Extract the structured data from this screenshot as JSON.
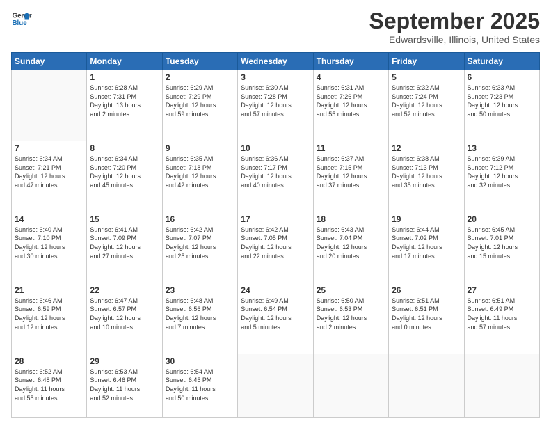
{
  "logo": {
    "line1": "General",
    "line2": "Blue"
  },
  "title": "September 2025",
  "location": "Edwardsville, Illinois, United States",
  "weekdays": [
    "Sunday",
    "Monday",
    "Tuesday",
    "Wednesday",
    "Thursday",
    "Friday",
    "Saturday"
  ],
  "weeks": [
    [
      {
        "day": "",
        "info": ""
      },
      {
        "day": "1",
        "info": "Sunrise: 6:28 AM\nSunset: 7:31 PM\nDaylight: 13 hours\nand 2 minutes."
      },
      {
        "day": "2",
        "info": "Sunrise: 6:29 AM\nSunset: 7:29 PM\nDaylight: 12 hours\nand 59 minutes."
      },
      {
        "day": "3",
        "info": "Sunrise: 6:30 AM\nSunset: 7:28 PM\nDaylight: 12 hours\nand 57 minutes."
      },
      {
        "day": "4",
        "info": "Sunrise: 6:31 AM\nSunset: 7:26 PM\nDaylight: 12 hours\nand 55 minutes."
      },
      {
        "day": "5",
        "info": "Sunrise: 6:32 AM\nSunset: 7:24 PM\nDaylight: 12 hours\nand 52 minutes."
      },
      {
        "day": "6",
        "info": "Sunrise: 6:33 AM\nSunset: 7:23 PM\nDaylight: 12 hours\nand 50 minutes."
      }
    ],
    [
      {
        "day": "7",
        "info": "Sunrise: 6:34 AM\nSunset: 7:21 PM\nDaylight: 12 hours\nand 47 minutes."
      },
      {
        "day": "8",
        "info": "Sunrise: 6:34 AM\nSunset: 7:20 PM\nDaylight: 12 hours\nand 45 minutes."
      },
      {
        "day": "9",
        "info": "Sunrise: 6:35 AM\nSunset: 7:18 PM\nDaylight: 12 hours\nand 42 minutes."
      },
      {
        "day": "10",
        "info": "Sunrise: 6:36 AM\nSunset: 7:17 PM\nDaylight: 12 hours\nand 40 minutes."
      },
      {
        "day": "11",
        "info": "Sunrise: 6:37 AM\nSunset: 7:15 PM\nDaylight: 12 hours\nand 37 minutes."
      },
      {
        "day": "12",
        "info": "Sunrise: 6:38 AM\nSunset: 7:13 PM\nDaylight: 12 hours\nand 35 minutes."
      },
      {
        "day": "13",
        "info": "Sunrise: 6:39 AM\nSunset: 7:12 PM\nDaylight: 12 hours\nand 32 minutes."
      }
    ],
    [
      {
        "day": "14",
        "info": "Sunrise: 6:40 AM\nSunset: 7:10 PM\nDaylight: 12 hours\nand 30 minutes."
      },
      {
        "day": "15",
        "info": "Sunrise: 6:41 AM\nSunset: 7:09 PM\nDaylight: 12 hours\nand 27 minutes."
      },
      {
        "day": "16",
        "info": "Sunrise: 6:42 AM\nSunset: 7:07 PM\nDaylight: 12 hours\nand 25 minutes."
      },
      {
        "day": "17",
        "info": "Sunrise: 6:42 AM\nSunset: 7:05 PM\nDaylight: 12 hours\nand 22 minutes."
      },
      {
        "day": "18",
        "info": "Sunrise: 6:43 AM\nSunset: 7:04 PM\nDaylight: 12 hours\nand 20 minutes."
      },
      {
        "day": "19",
        "info": "Sunrise: 6:44 AM\nSunset: 7:02 PM\nDaylight: 12 hours\nand 17 minutes."
      },
      {
        "day": "20",
        "info": "Sunrise: 6:45 AM\nSunset: 7:01 PM\nDaylight: 12 hours\nand 15 minutes."
      }
    ],
    [
      {
        "day": "21",
        "info": "Sunrise: 6:46 AM\nSunset: 6:59 PM\nDaylight: 12 hours\nand 12 minutes."
      },
      {
        "day": "22",
        "info": "Sunrise: 6:47 AM\nSunset: 6:57 PM\nDaylight: 12 hours\nand 10 minutes."
      },
      {
        "day": "23",
        "info": "Sunrise: 6:48 AM\nSunset: 6:56 PM\nDaylight: 12 hours\nand 7 minutes."
      },
      {
        "day": "24",
        "info": "Sunrise: 6:49 AM\nSunset: 6:54 PM\nDaylight: 12 hours\nand 5 minutes."
      },
      {
        "day": "25",
        "info": "Sunrise: 6:50 AM\nSunset: 6:53 PM\nDaylight: 12 hours\nand 2 minutes."
      },
      {
        "day": "26",
        "info": "Sunrise: 6:51 AM\nSunset: 6:51 PM\nDaylight: 12 hours\nand 0 minutes."
      },
      {
        "day": "27",
        "info": "Sunrise: 6:51 AM\nSunset: 6:49 PM\nDaylight: 11 hours\nand 57 minutes."
      }
    ],
    [
      {
        "day": "28",
        "info": "Sunrise: 6:52 AM\nSunset: 6:48 PM\nDaylight: 11 hours\nand 55 minutes."
      },
      {
        "day": "29",
        "info": "Sunrise: 6:53 AM\nSunset: 6:46 PM\nDaylight: 11 hours\nand 52 minutes."
      },
      {
        "day": "30",
        "info": "Sunrise: 6:54 AM\nSunset: 6:45 PM\nDaylight: 11 hours\nand 50 minutes."
      },
      {
        "day": "",
        "info": ""
      },
      {
        "day": "",
        "info": ""
      },
      {
        "day": "",
        "info": ""
      },
      {
        "day": "",
        "info": ""
      }
    ]
  ]
}
